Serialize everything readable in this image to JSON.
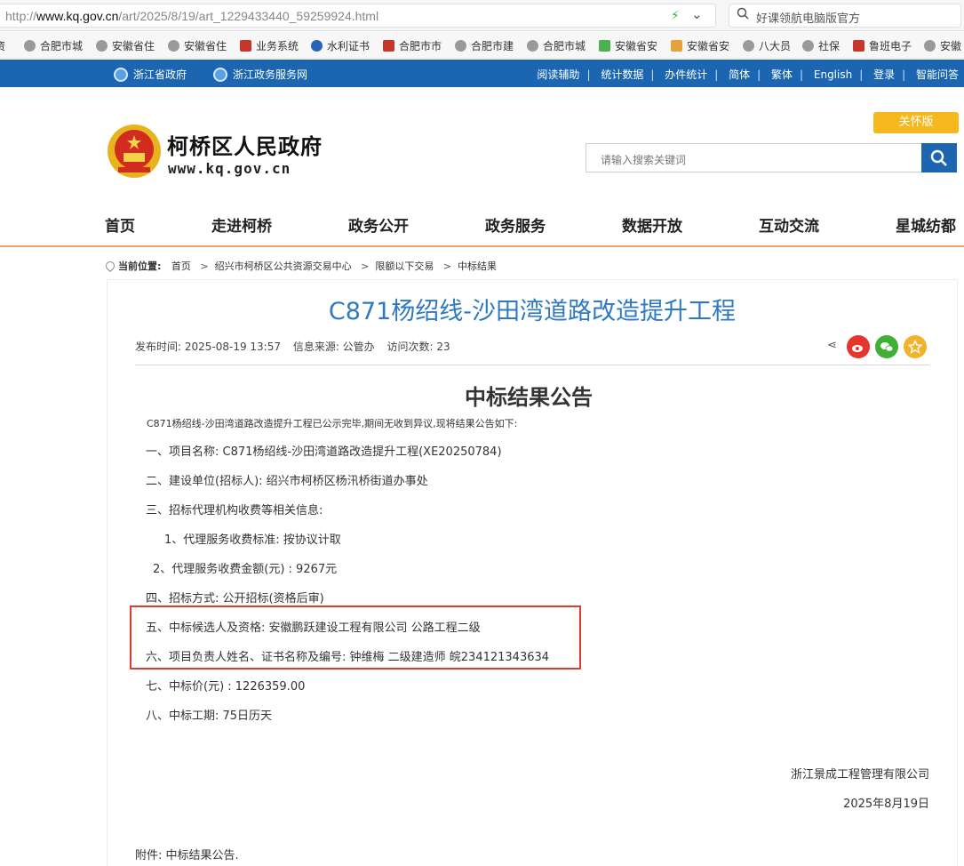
{
  "browser": {
    "url_prefix": "http://",
    "url_domain": "www.kq.gov.cn",
    "url_path": "/art/2025/8/19/art_1229433440_59259924.html",
    "search_placeholder": "好课领航电脑版官方"
  },
  "bookmarks": [
    {
      "label": "资"
    },
    {
      "label": "合肥市城"
    },
    {
      "label": "安徽省住"
    },
    {
      "label": "安徽省住"
    },
    {
      "label": "业务系统"
    },
    {
      "label": "水利证书"
    },
    {
      "label": "合肥市市"
    },
    {
      "label": "合肥市建"
    },
    {
      "label": "合肥市城"
    },
    {
      "label": "安徽省安"
    },
    {
      "label": "安徽省安"
    },
    {
      "label": "八大员"
    },
    {
      "label": "社保"
    },
    {
      "label": "鲁班电子"
    },
    {
      "label": "安徽"
    }
  ],
  "gov_bar": {
    "link1": "浙江省政府",
    "link2": "浙江政务服务网",
    "menu": [
      "阅读辅助",
      "统计数据",
      "办件统计",
      "简体",
      "繁体",
      "English",
      "登录",
      "智能问答"
    ],
    "sep": "|"
  },
  "header": {
    "site_name": "柯桥区人民政府",
    "site_domain": "www.kq.gov.cn",
    "care_mode": "关怀版",
    "search_placeholder": "请输入搜索关键词"
  },
  "nav": [
    "首页",
    "走进柯桥",
    "政务公开",
    "政务服务",
    "数据开放",
    "互动交流",
    "星城纺都"
  ],
  "breadcrumb": {
    "label": "当前位置:",
    "items": [
      "首页",
      "绍兴市柯桥区公共资源交易中心",
      "限额以下交易",
      "中标结果"
    ],
    "arrow": ">"
  },
  "article": {
    "title": "C871杨绍线-沙田湾道路改造提升工程",
    "meta_time": "发布时间: 2025-08-19 13:57",
    "meta_source": "信息来源: 公管办",
    "meta_visits": "访问次数: 23",
    "heading": "中标结果公告",
    "intro": "C871杨绍线-沙田湾道路改造提升工程已公示完毕,期间无收到异议,现将结果公告如下:",
    "lines": [
      "一、项目名称: C871杨绍线-沙田湾道路改造提升工程(XE20250784)",
      "二、建设单位(招标人): 绍兴市柯桥区杨汛桥街道办事处",
      "三、招标代理机构收费等相关信息:",
      "1、代理服务收费标准: 按协议计取",
      "2、代理服务收费金额(元) : 9267元",
      "四、招标方式: 公开招标(资格后审)",
      "五、中标候选人及资格: 安徽鹏跃建设工程有限公司 公路工程二级",
      "六、项目负责人姓名、证书名称及编号: 钟维梅 二级建造师 皖234121343634",
      "七、中标价(元) : 1226359.00",
      "八、中标工期: 75日历天"
    ],
    "signer": "浙江景成工程管理有限公司",
    "date": "2025年8月19日",
    "attachment": "附件: 中标结果公告."
  },
  "colors": {
    "gov_blue": "#1b65b1",
    "title_blue": "#2f78c4",
    "care_yellow": "#f5b81f",
    "highlight_red": "#e33a2e",
    "nav_underline": "#e8a26a"
  }
}
